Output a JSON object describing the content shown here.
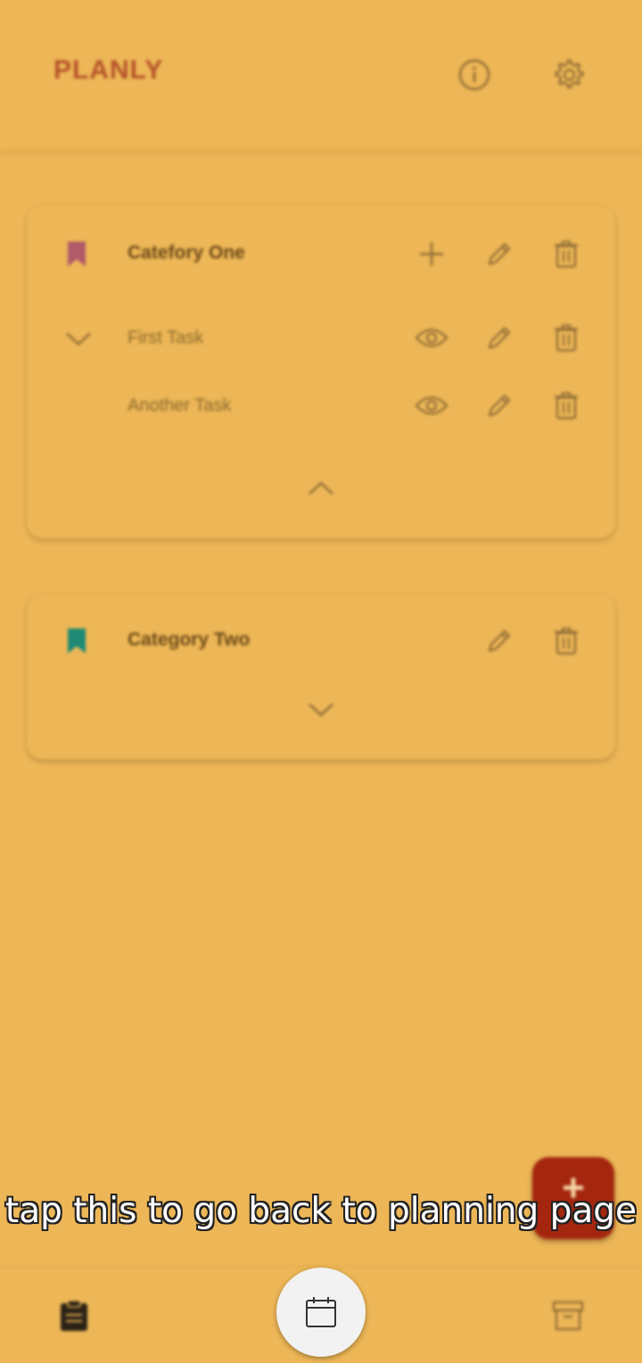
{
  "header": {
    "title": "PLANLY",
    "info_icon": "info-icon",
    "settings_icon": "gear-icon"
  },
  "categories": [
    {
      "title": "Catefory One",
      "bookmark_color": "#B05A6A",
      "expanded": true,
      "tasks": [
        {
          "title": "First Task"
        },
        {
          "title": "Another Task"
        }
      ]
    },
    {
      "title": "Category Two",
      "bookmark_color": "#1F8A73",
      "expanded": false,
      "tasks": []
    }
  ],
  "overlay": {
    "hint": "tap this to go back to planning page"
  },
  "fab": {
    "icon": "plus-icon",
    "color": "#A5260E"
  },
  "bottom_nav": {
    "left_icon": "clipboard-icon",
    "center_icon": "calendar-icon",
    "right_icon": "archive-icon"
  },
  "colors": {
    "background": "#EDB656",
    "accent": "#B5532A",
    "icon": "#8C6A35"
  }
}
